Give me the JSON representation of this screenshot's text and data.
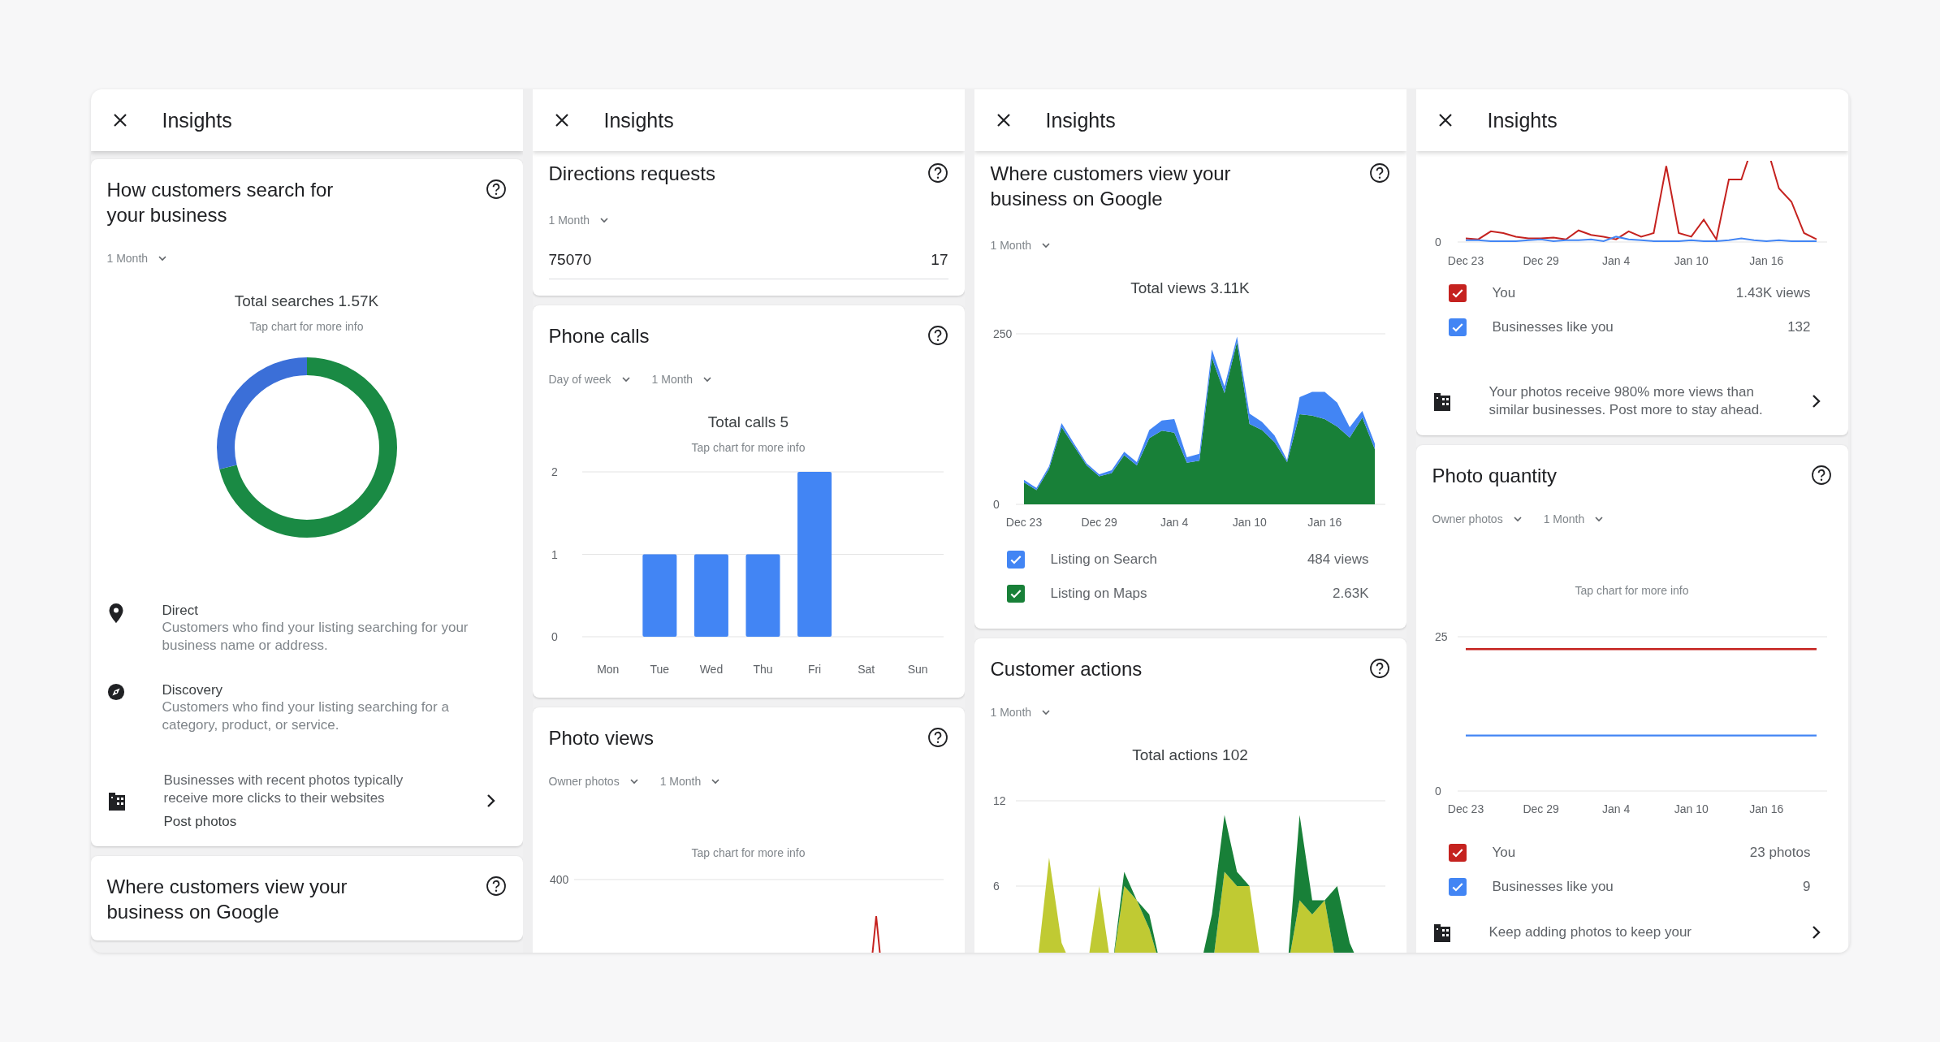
{
  "panels": [
    {
      "header": {
        "title": "Insights"
      },
      "cards": [
        {
          "cut_top": false,
          "title": "How customers search for your business",
          "filters": [
            {
              "label": "1 Month"
            }
          ],
          "total": "Total searches 1.57K",
          "hint": "Tap chart for more info",
          "chart": {
            "kind": "donut"
          },
          "descriptions": [
            {
              "kind": "pin",
              "title": "Direct",
              "text": "Customers who find your listing searching for your business name or address."
            },
            {
              "kind": "compass",
              "title": "Discovery",
              "text": "Customers who find your listing searching for a category, product, or service."
            }
          ],
          "tip": {
            "text": "Businesses with recent photos typically receive more clicks to their websites",
            "link": "Post photos"
          }
        },
        {
          "cut_top": false,
          "title": "Where customers view your business on Google"
        }
      ]
    },
    {
      "header": {
        "title": "Insights"
      },
      "cards": [
        {
          "cut_top": true,
          "title": "Directions requests",
          "filters": [
            {
              "label": "1 Month"
            }
          ],
          "value_row": {
            "label": "75070",
            "value": "17"
          }
        },
        {
          "cut_top": false,
          "title": "Phone calls",
          "filters": [
            {
              "label": "Day of week"
            },
            {
              "label": "1 Month"
            }
          ],
          "total": "Total calls 5",
          "hint": "Tap chart for more info",
          "chart": {
            "kind": "bar",
            "chart_data": {
              "type": "bar",
              "categories": [
                "Mon",
                "Tue",
                "Wed",
                "Thu",
                "Fri",
                "Sat",
                "Sun"
              ],
              "values": [
                0,
                1,
                1,
                1,
                2,
                0,
                0
              ],
              "ylim": [
                0,
                2
              ],
              "yticks": [
                0,
                1,
                2
              ]
            }
          }
        },
        {
          "cut_top": false,
          "title": "Photo views",
          "filters": [
            {
              "label": "Owner photos"
            },
            {
              "label": "1 Month"
            }
          ],
          "hint": "Tap chart for more info",
          "chart": {
            "kind": "spike",
            "ticks": [
              "400"
            ]
          }
        }
      ]
    },
    {
      "header": {
        "title": "Insights"
      },
      "cards": [
        {
          "cut_top": true,
          "title": "Where customers view your business on Google",
          "filters": [
            {
              "label": "1 Month"
            }
          ],
          "total": "Total views 3.11K",
          "chart": {
            "kind": "area",
            "chart_data": {
              "type": "area",
              "stacked": true,
              "ylim": [
                0,
                250
              ],
              "yticks": [
                0,
                250
              ],
              "categories": [
                "Dec 23",
                null,
                null,
                null,
                null,
                null,
                "Dec 29",
                null,
                null,
                null,
                null,
                null,
                "Jan 4",
                null,
                null,
                null,
                null,
                null,
                "Jan 10",
                null,
                null,
                null,
                null,
                null,
                "Jan 16",
                null,
                null,
                null,
                null
              ],
              "series": [
                {
                  "color": "#188038",
                  "values": [
                    32,
                    21,
                    52,
                    113,
                    85,
                    57,
                    41,
                    46,
                    72,
                    57,
                    97,
                    108,
                    105,
                    61,
                    64,
                    215,
                    163,
                    238,
                    118,
                    109,
                    91,
                    62,
                    132,
                    130,
                    125,
                    114,
                    98,
                    127,
                    81
                  ]
                },
                {
                  "color": "#4285f4",
                  "values": [
                    4,
                    3,
                    4,
                    6,
                    4,
                    3,
                    3,
                    4,
                    5,
                    5,
                    12,
                    15,
                    20,
                    8,
                    10,
                    12,
                    10,
                    8,
                    15,
                    12,
                    10,
                    3,
                    25,
                    35,
                    40,
                    35,
                    15,
                    10,
                    8
                  ]
                }
              ]
            }
          },
          "legend": [
            {
              "label": "Listing on Search",
              "value": "484 views",
              "checked": true,
              "color": "#4285f4"
            },
            {
              "label": "Listing on Maps",
              "value": "2.63K",
              "checked": true,
              "color": "#188038"
            }
          ]
        },
        {
          "cut_top": false,
          "title": "Customer actions",
          "filters": [
            {
              "label": "1 Month"
            }
          ],
          "total": "Total actions 102",
          "chart": {
            "kind": "area",
            "chart_data": {
              "type": "area",
              "stacked": true,
              "ylim": [
                0,
                12
              ],
              "yticks": [
                6,
                12
              ],
              "series": [
                {
                  "color": "#c0ca33",
                  "values": [
                    0,
                    0,
                    8,
                    2,
                    0,
                    0,
                    6,
                    0,
                    6,
                    5,
                    3,
                    0,
                    0,
                    0,
                    0,
                    0,
                    7,
                    6,
                    6,
                    0,
                    0,
                    0,
                    5,
                    4,
                    5,
                    0,
                    0,
                    0,
                    0
                  ]
                },
                {
                  "color": "#188038",
                  "values": [
                    0,
                    0,
                    0,
                    0,
                    0,
                    0,
                    0,
                    0,
                    1,
                    0,
                    1,
                    0,
                    0,
                    0,
                    0,
                    4,
                    4,
                    1,
                    0,
                    0,
                    0,
                    0,
                    6,
                    1,
                    0,
                    6,
                    2,
                    0,
                    0
                  ]
                }
              ]
            }
          }
        }
      ]
    },
    {
      "header": {
        "title": "Insights"
      },
      "cards": [
        {
          "cut_top": true,
          "chart": {
            "kind": "lines",
            "ticks": [
              "0"
            ],
            "xlabels": [
              "Dec 23",
              "Dec 29",
              "Jan 4",
              "Jan 10",
              "Jan 16"
            ]
          },
          "legend": [
            {
              "label": "You",
              "value": "1.43K views",
              "checked": true,
              "color": "#c5221f"
            },
            {
              "label": "Businesses like you",
              "value": "132",
              "checked": true,
              "color": "#4285f4"
            }
          ],
          "tip": {
            "text": "Your photos receive 980% more views than similar businesses. Post more to stay ahead."
          }
        },
        {
          "cut_top": false,
          "title": "Photo quantity",
          "filters": [
            {
              "label": "Owner photos"
            },
            {
              "label": "1 Month"
            }
          ],
          "hint": "Tap chart for more info",
          "chart": {
            "kind": "line",
            "chart_data": {
              "type": "line",
              "ylim": [
                0,
                25
              ],
              "yticks": [
                0,
                25
              ],
              "categories": [
                "Dec 23",
                null,
                null,
                null,
                null,
                null,
                "Dec 29",
                null,
                null,
                null,
                null,
                null,
                "Jan 4",
                null,
                null,
                null,
                null,
                null,
                "Jan 10",
                null,
                null,
                null,
                null,
                null,
                "Jan 16",
                null,
                null,
                null,
                null
              ],
              "series": [
                {
                  "color": "#c5221f",
                  "values": [
                    23,
                    23,
                    23,
                    23,
                    23,
                    23,
                    23,
                    23,
                    23,
                    23,
                    23,
                    23,
                    23,
                    23,
                    23,
                    23,
                    23,
                    23,
                    23,
                    23,
                    23,
                    23,
                    23,
                    23,
                    23,
                    23,
                    23,
                    23,
                    23
                  ]
                },
                {
                  "color": "#4285f4",
                  "values": [
                    9,
                    9,
                    9,
                    9,
                    9,
                    9,
                    9,
                    9,
                    9,
                    9,
                    9,
                    9,
                    9,
                    9,
                    9,
                    9,
                    9,
                    9,
                    9,
                    9,
                    9,
                    9,
                    9,
                    9,
                    9,
                    9,
                    9,
                    9,
                    9
                  ]
                }
              ]
            }
          },
          "legend": [
            {
              "label": "You",
              "value": "23 photos",
              "checked": true,
              "color": "#c5221f"
            },
            {
              "label": "Businesses like you",
              "value": "9",
              "checked": true,
              "color": "#4285f4"
            }
          ],
          "tip": {
            "text": "Keep adding photos to keep your"
          }
        }
      ]
    }
  ]
}
